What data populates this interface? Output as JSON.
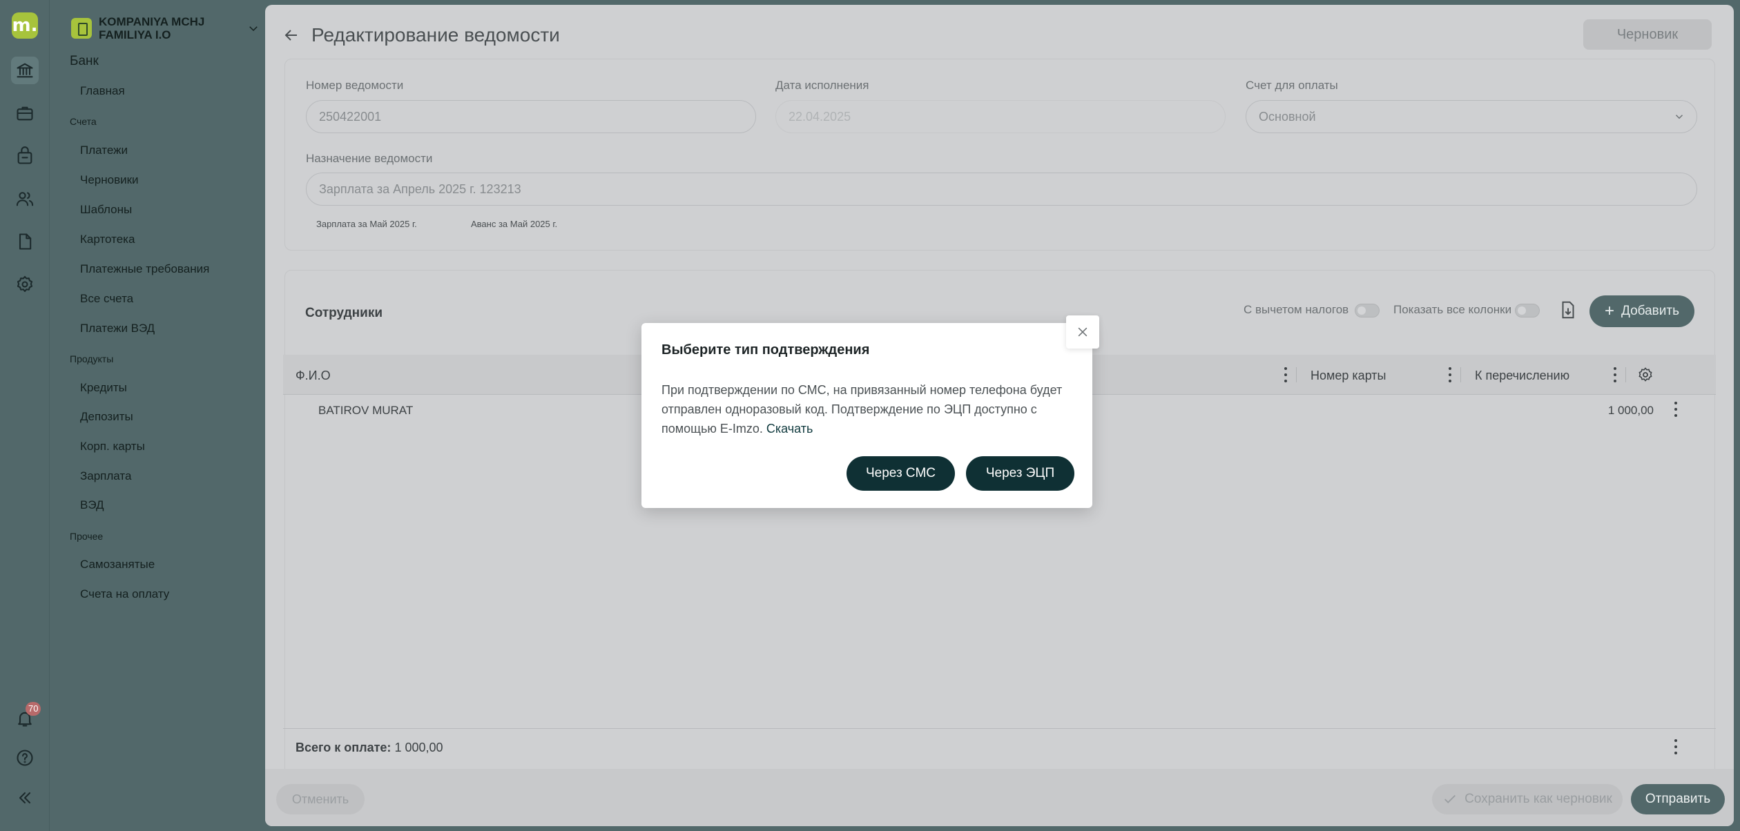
{
  "app": {
    "logo_text": "m.",
    "company_name": "KOMPANIYA MCHJ FAMILIYA I.O",
    "notification_count": "70"
  },
  "sidebar": {
    "bank_title": "Банк",
    "home": "Главная",
    "accounts_title": "Счета",
    "accounts": [
      "Платежи",
      "Черновики",
      "Шаблоны",
      "Картотека",
      "Платежные требования",
      "Все счета",
      "Платежи ВЭД"
    ],
    "products_title": "Продукты",
    "products": [
      "Кредиты",
      "Депозиты",
      "Корп. карты",
      "Зарплата",
      "ВЭД"
    ],
    "other_title": "Прочее",
    "other": [
      "Самозанятые",
      "Счета на оплату"
    ]
  },
  "header": {
    "title": "Редактирование ведомости",
    "status": "Черновик"
  },
  "form": {
    "number_label": "Номер ведомости",
    "number_value": "250422001",
    "date_label": "Дата исполнения",
    "date_value": "22.04.2025",
    "account_label": "Счет для оплаты",
    "account_value": "Основной",
    "purpose_label": "Назначение ведомости",
    "purpose_value": "Зарплата за Апрель 2025 г. 123213",
    "chips": [
      "Зарплата за Май 2025 г.",
      "Аванс за Май 2025 г."
    ]
  },
  "employees": {
    "title": "Сотрудники",
    "toggle_taxes": "С вычетом налогов",
    "toggle_columns": "Показать все колонки",
    "add_label": "Добавить",
    "columns": [
      "Ф.И.О",
      "Номер карты",
      "К перечислению"
    ],
    "rows": [
      {
        "name": "BATIROV MURAT",
        "card": "",
        "amount": "1 000,00"
      }
    ],
    "total_label": "Всего к оплате:",
    "total_value": "1 000,00"
  },
  "footer": {
    "cancel": "Отменить",
    "save_draft": "Сохранить как черновик",
    "send": "Отправить"
  },
  "modal": {
    "title": "Выберите тип подтверждения",
    "text": "При подтверждении по СМС, на привязанный номер телефона будет отправлен одноразовый код. Подтверждение по ЭЦП доступно с помощью E-Imzo.",
    "link": "Скачать",
    "sms_button": "Через СМС",
    "eds_button": "Через ЭЦП"
  },
  "colors": {
    "accent": "#a7c33c",
    "sidebar": "#52686a",
    "primary_button": "#0f3034"
  }
}
